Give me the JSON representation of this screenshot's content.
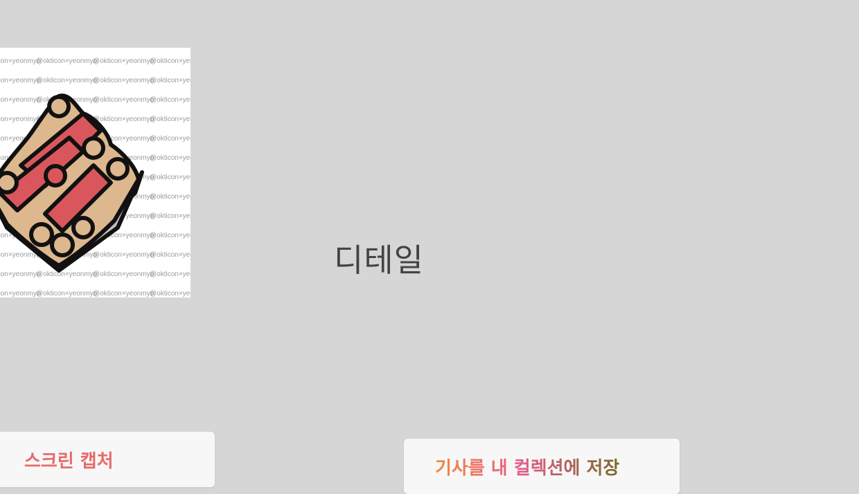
{
  "page": {
    "background": "#d6d6d6"
  },
  "thumbnail": {
    "watermark_text": "@okticon×yeonmyo",
    "sticker_icon": "sushi-sticker-icon",
    "colors": {
      "fish": "#d9575c",
      "rice": "#ddb78e",
      "plate": "#bdbdbd",
      "outline": "#111111"
    }
  },
  "label": {
    "text": "디테일"
  },
  "cards": [
    {
      "title": "스크린 캡처",
      "color": "#e66b6b"
    },
    {
      "title": "기사를 내 컬렉션에 저장",
      "colors": [
        "#f08a3c",
        "#e65c8a",
        "#7a6a2a"
      ]
    }
  ]
}
